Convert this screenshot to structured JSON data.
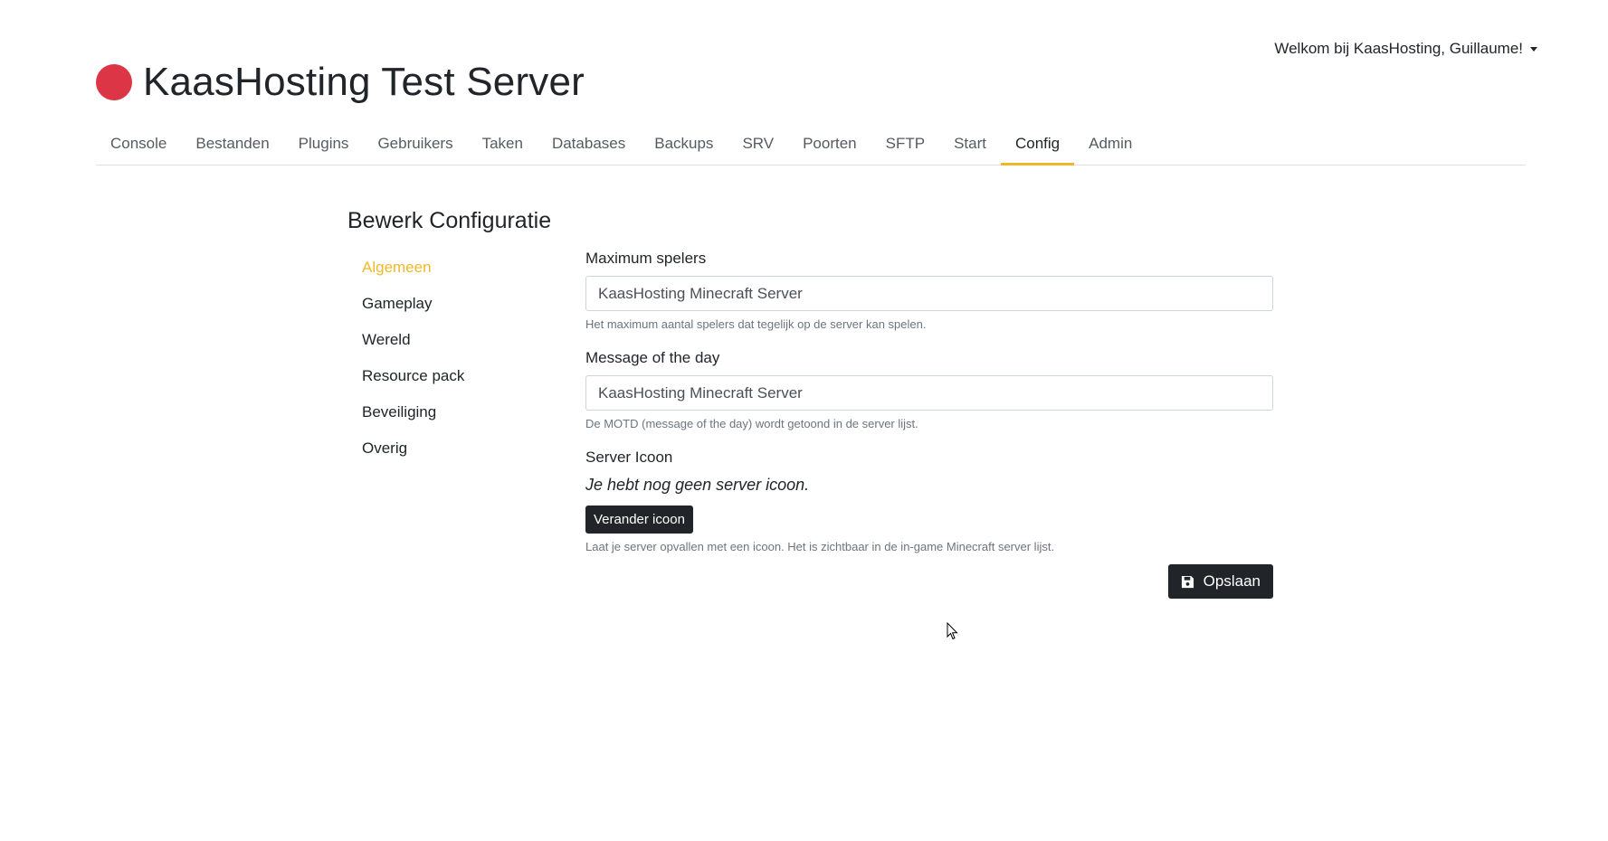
{
  "user_menu": {
    "label": "Welkom bij KaasHosting, Guillaume!"
  },
  "server": {
    "title": "KaasHosting Test Server",
    "status_color": "#dc3545"
  },
  "tabs": [
    {
      "label": "Console"
    },
    {
      "label": "Bestanden"
    },
    {
      "label": "Plugins"
    },
    {
      "label": "Gebruikers"
    },
    {
      "label": "Taken"
    },
    {
      "label": "Databases"
    },
    {
      "label": "Backups"
    },
    {
      "label": "SRV"
    },
    {
      "label": "Poorten"
    },
    {
      "label": "SFTP"
    },
    {
      "label": "Start"
    },
    {
      "label": "Config"
    },
    {
      "label": "Admin"
    }
  ],
  "active_tab": "Config",
  "accent_color": "#f0b72a",
  "page_title": "Bewerk Configuratie",
  "side_nav": [
    {
      "label": "Algemeen"
    },
    {
      "label": "Gameplay"
    },
    {
      "label": "Wereld"
    },
    {
      "label": "Resource pack"
    },
    {
      "label": "Beveiliging"
    },
    {
      "label": "Overig"
    }
  ],
  "active_side": "Algemeen",
  "form": {
    "max_players": {
      "label": "Maximum spelers",
      "value": "KaasHosting Minecraft Server",
      "help": "Het maximum aantal spelers dat tegelijk op de server kan spelen."
    },
    "motd": {
      "label": "Message of the day",
      "value": "KaasHosting Minecraft Server",
      "help": "De MOTD (message of the day) wordt getoond in de server lijst."
    },
    "server_icon": {
      "label": "Server Icoon",
      "empty_text": "Je hebt nog geen server icoon.",
      "button_label": "Verander icoon",
      "help": "Laat je server opvallen met een icoon. Het is zichtbaar in de in-game Minecraft server lijst."
    },
    "save_label": "Opslaan",
    "save_icon": "save-icon"
  }
}
